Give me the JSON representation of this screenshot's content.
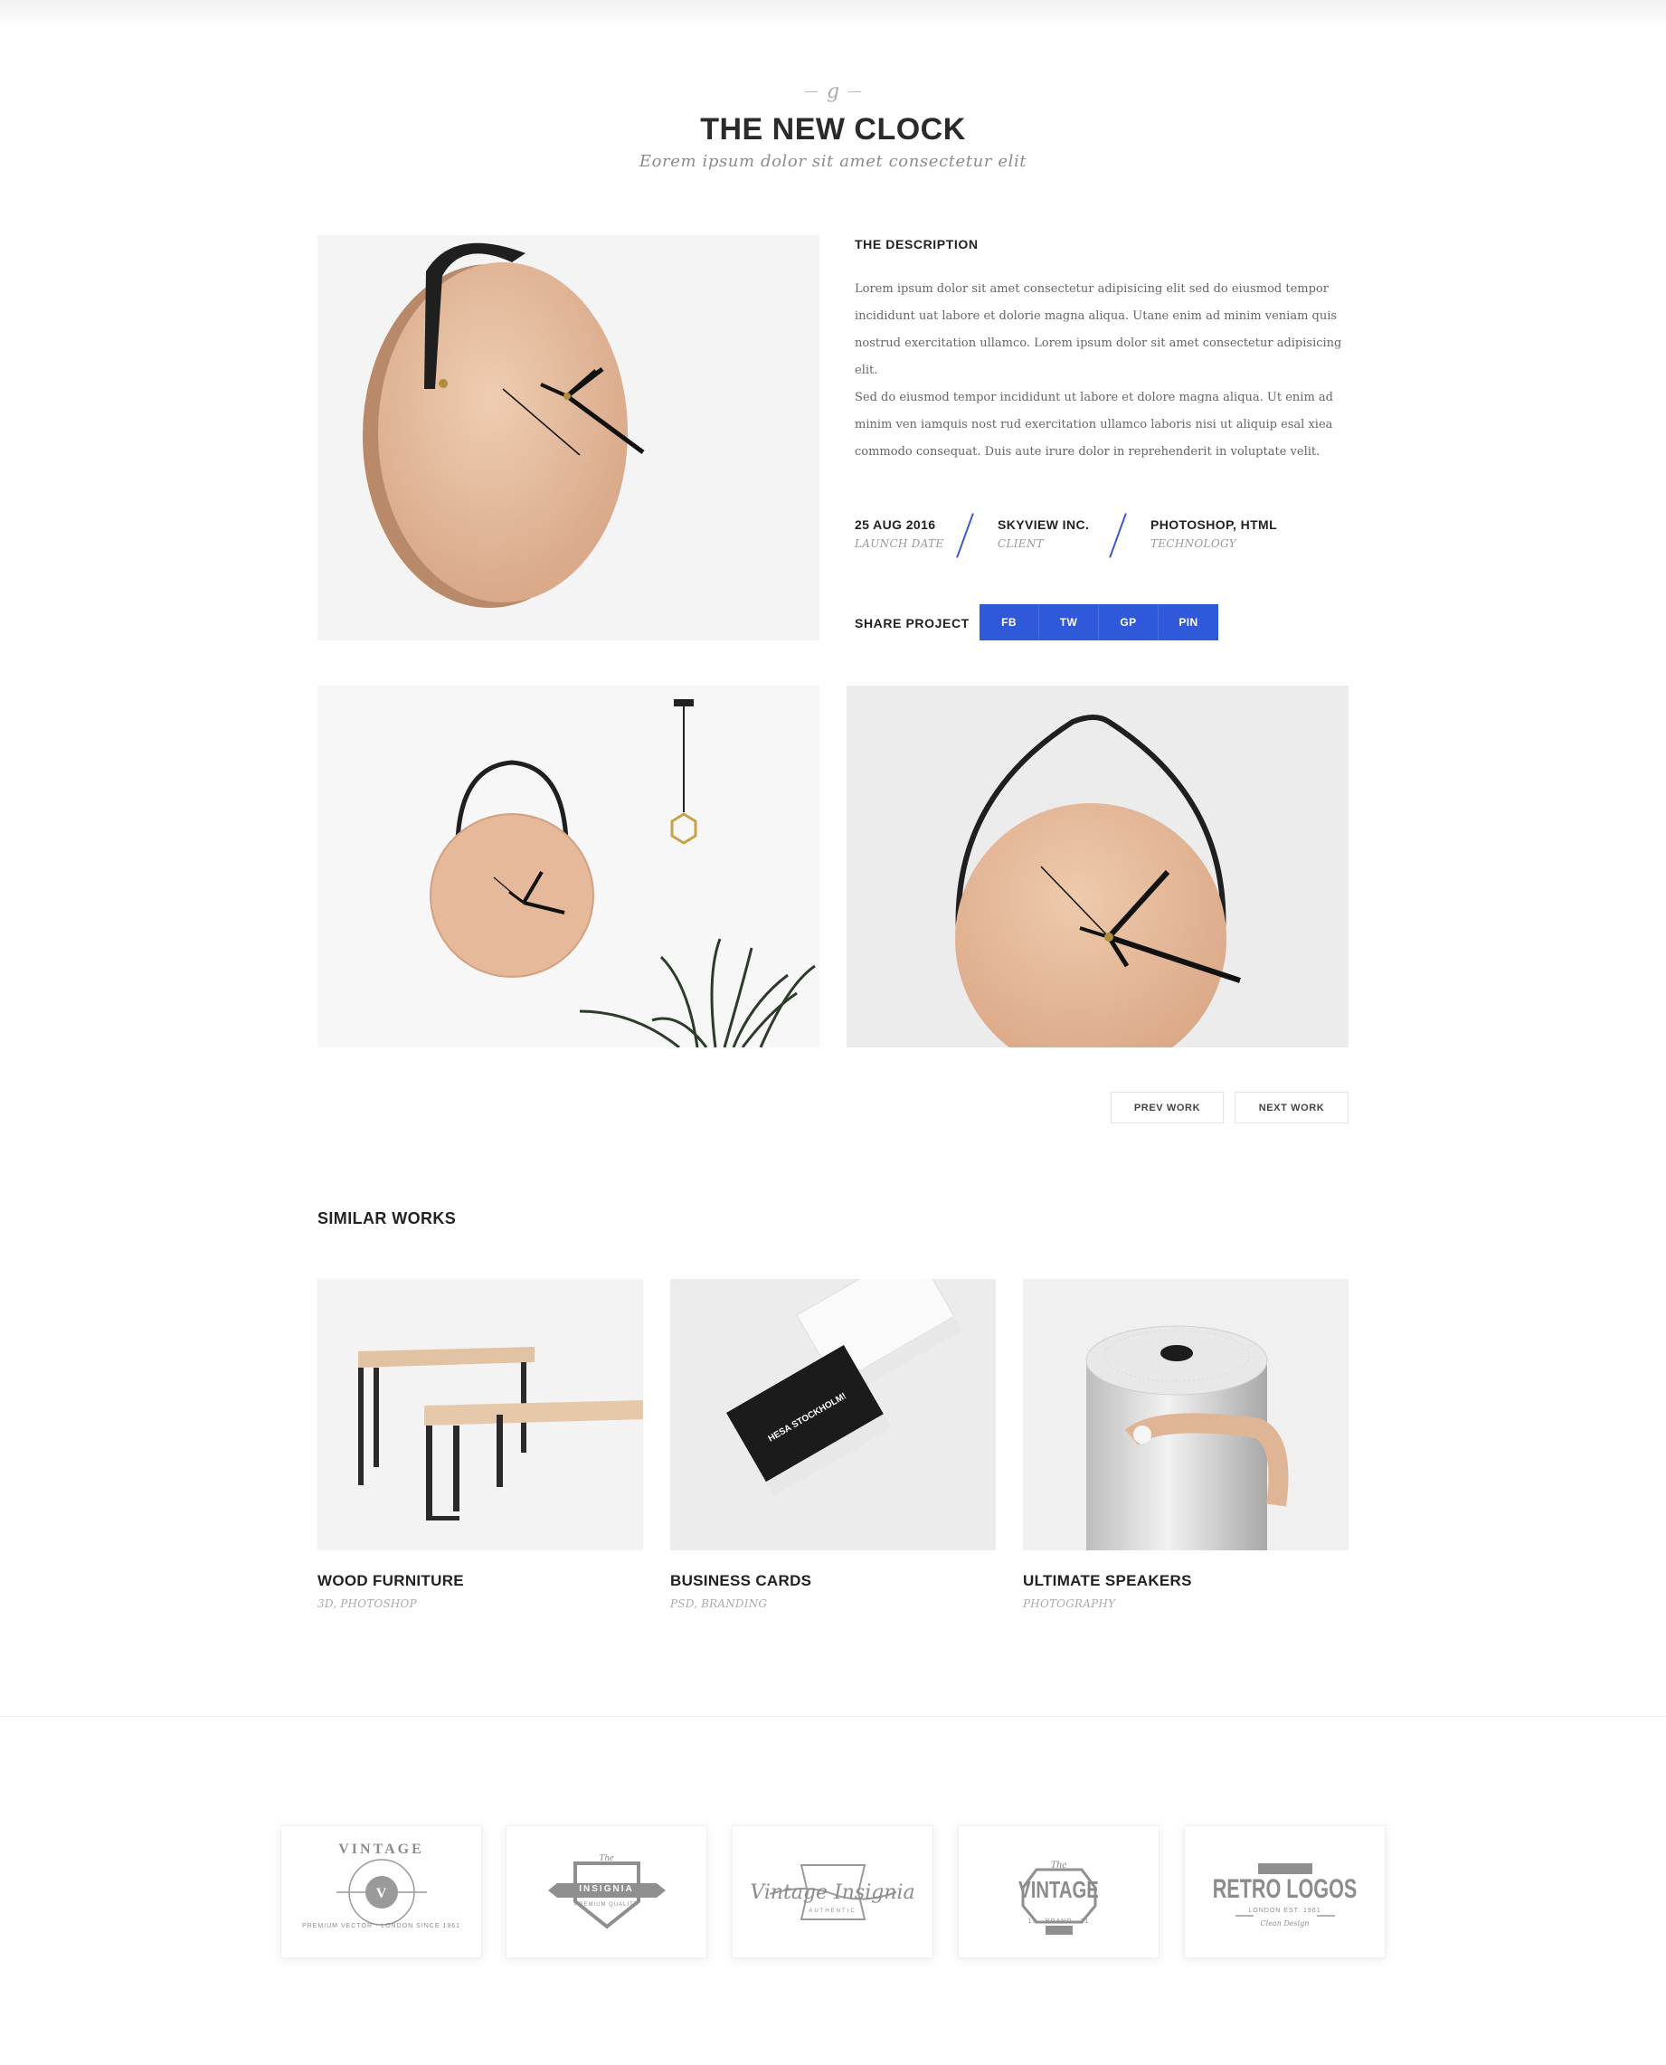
{
  "header": {
    "ornament": "g",
    "title": "THE NEW CLOCK",
    "subtitle": "Eorem ipsum dolor sit amet consectetur elit"
  },
  "description": {
    "heading": "THE DESCRIPTION",
    "paragraph1": "Lorem ipsum dolor sit amet consectetur adipisicing elit sed do eiusmod tempor incididunt uat labore et dolorie magna aliqua. Utane enim ad minim veniam quis nostrud exercitation ullamco. Lorem ipsum dolor sit amet consectetur adipisicing elit.",
    "paragraph2": "Sed do eiusmod tempor incididunt ut labore et dolore magna aliqua. Ut enim ad minim ven iamquis nost rud exercitation ullamco laboris nisi ut aliquip esal xiea commodo consequat. Duis aute irure dolor in reprehenderit in voluptate velit."
  },
  "meta": [
    {
      "value": "25 AUG 2016",
      "label": "LAUNCH DATE"
    },
    {
      "value": "SKYVIEW INC.",
      "label": "CLIENT"
    },
    {
      "value": "PHOTOSHOP, HTML",
      "label": "TECHNOLOGY"
    }
  ],
  "share": {
    "label": "SHARE PROJECT",
    "buttons": [
      "FB",
      "TW",
      "GP",
      "PIN"
    ],
    "color": "#2f59d9"
  },
  "pager": {
    "prev": "PREV WORK",
    "next": "NEXT WORK"
  },
  "similar": {
    "title": "SIMILAR WORKS",
    "items": [
      {
        "title": "WOOD FURNITURE",
        "tags": "3D, PHOTOSHOP"
      },
      {
        "title": "BUSINESS CARDS",
        "tags": "PSD, BRANDING"
      },
      {
        "title": "ULTIMATE SPEAKERS",
        "tags": "PHOTOGRAPHY"
      }
    ]
  },
  "card_text": {
    "name": "HESA STOCKHOLM!"
  },
  "logos": [
    {
      "top": "VINTAGE",
      "bottom": "PREMIUM VECTOR · LONDON SINCE 1961",
      "mark": "V"
    },
    {
      "top": "The",
      "main": "INSIGNIA",
      "bottom": "PREMIUM QUALITY"
    },
    {
      "main": "Vintage Insignia",
      "bottom": "AUTHENTIC"
    },
    {
      "top": "The",
      "main": "VINTAGE",
      "bottom": "19 · BRAND · 21"
    },
    {
      "top": "AUTHENTIC",
      "main": "RETRO LOGOS",
      "bottom": "LONDON EST. 1961",
      "sub": "Clean Design"
    }
  ],
  "colors": {
    "accent": "#2f59d9",
    "wood": "#e6bfa0"
  }
}
